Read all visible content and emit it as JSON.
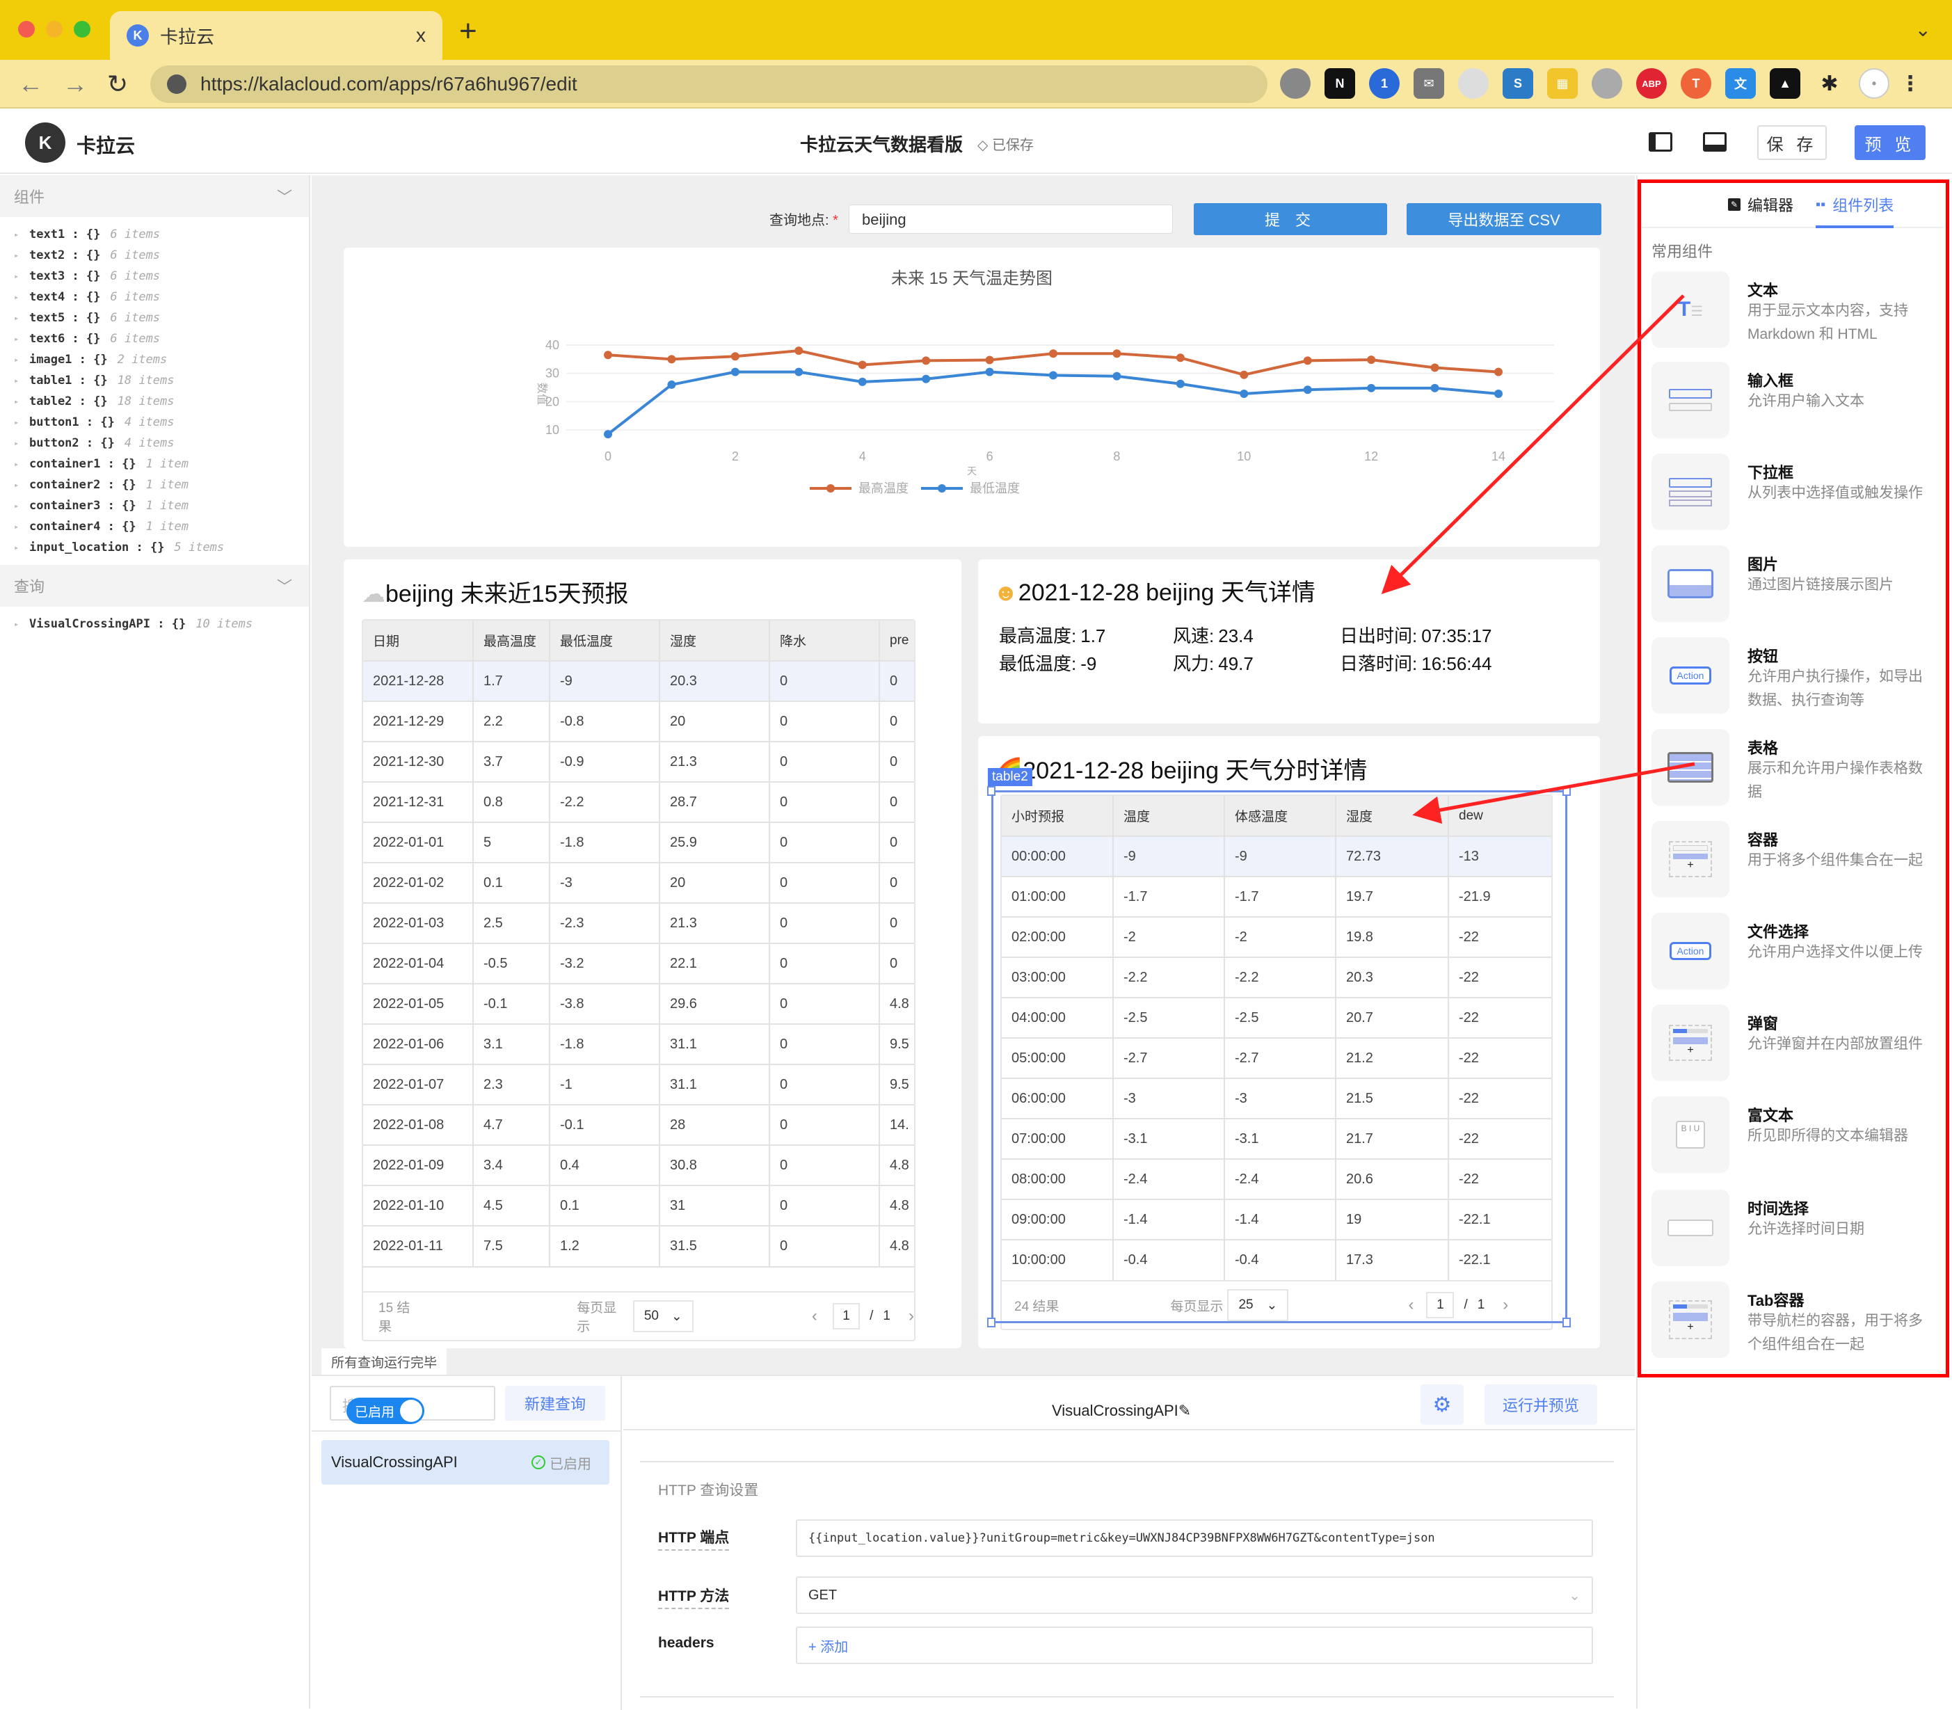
{
  "browser": {
    "tab_title": "卡拉云",
    "tab_close": "x",
    "new_tab": "+",
    "url": "https://kalacloud.com/apps/r67a6hu967/edit",
    "extensions": [
      "tomato-icon",
      "notion-icon",
      "1password-icon",
      "mail-icon",
      "gray-leaf-icon",
      "s-icon",
      "grid-icon",
      "egg-icon",
      "adblock-icon",
      "t-icon",
      "translate-icon",
      "a-icon",
      "puzzle-icon",
      "rabbit-avatar-icon"
    ]
  },
  "header": {
    "brand": "卡拉云",
    "app_title": "卡拉云天气数据看版",
    "saved_status": "已保存",
    "save_label": "保 存",
    "preview_label": "预 览"
  },
  "left_panel": {
    "components_title": "组件",
    "components": [
      {
        "key": "text1",
        "type": "{}",
        "count": "6 items"
      },
      {
        "key": "text2",
        "type": "{}",
        "count": "6 items"
      },
      {
        "key": "text3",
        "type": "{}",
        "count": "6 items"
      },
      {
        "key": "text4",
        "type": "{}",
        "count": "6 items"
      },
      {
        "key": "text5",
        "type": "{}",
        "count": "6 items"
      },
      {
        "key": "text6",
        "type": "{}",
        "count": "6 items"
      },
      {
        "key": "image1",
        "type": "{}",
        "count": "2 items"
      },
      {
        "key": "table1",
        "type": "{}",
        "count": "18 items"
      },
      {
        "key": "table2",
        "type": "{}",
        "count": "18 items"
      },
      {
        "key": "button1",
        "type": "{}",
        "count": "4 items"
      },
      {
        "key": "button2",
        "type": "{}",
        "count": "4 items"
      },
      {
        "key": "container1",
        "type": "{}",
        "count": "1 item"
      },
      {
        "key": "container2",
        "type": "{}",
        "count": "1 item"
      },
      {
        "key": "container3",
        "type": "{}",
        "count": "1 item"
      },
      {
        "key": "container4",
        "type": "{}",
        "count": "1 item"
      },
      {
        "key": "input_location",
        "type": "{}",
        "count": "5 items"
      }
    ],
    "queries_title": "查询",
    "queries": [
      {
        "key": "VisualCrossingAPI",
        "type": "{}",
        "count": "10 items"
      }
    ]
  },
  "canvas": {
    "location_label": "查询地点:",
    "location_value": "beijing",
    "submit_label": "提 交",
    "export_label": "导出数据至 CSV",
    "forecast": {
      "title": "beijing 未来近15天预报",
      "columns": [
        "日期",
        "最高温度",
        "最低温度",
        "湿度",
        "降水",
        "pre"
      ],
      "rows": [
        [
          "2021-12-28",
          "1.7",
          "-9",
          "20.3",
          "0",
          "0"
        ],
        [
          "2021-12-29",
          "2.2",
          "-0.8",
          "20",
          "0",
          "0"
        ],
        [
          "2021-12-30",
          "3.7",
          "-0.9",
          "21.3",
          "0",
          "0"
        ],
        [
          "2021-12-31",
          "0.8",
          "-2.2",
          "28.7",
          "0",
          "0"
        ],
        [
          "2022-01-01",
          "5",
          "-1.8",
          "25.9",
          "0",
          "0"
        ],
        [
          "2022-01-02",
          "0.1",
          "-3",
          "20",
          "0",
          "0"
        ],
        [
          "2022-01-03",
          "2.5",
          "-2.3",
          "21.3",
          "0",
          "0"
        ],
        [
          "2022-01-04",
          "-0.5",
          "-3.2",
          "22.1",
          "0",
          "0"
        ],
        [
          "2022-01-05",
          "-0.1",
          "-3.8",
          "29.6",
          "0",
          "4.8"
        ],
        [
          "2022-01-06",
          "3.1",
          "-1.8",
          "31.1",
          "0",
          "9.5"
        ],
        [
          "2022-01-07",
          "2.3",
          "-1",
          "31.1",
          "0",
          "9.5"
        ],
        [
          "2022-01-08",
          "4.7",
          "-0.1",
          "28",
          "0",
          "14."
        ],
        [
          "2022-01-09",
          "3.4",
          "0.4",
          "30.8",
          "0",
          "4.8"
        ],
        [
          "2022-01-10",
          "4.5",
          "0.1",
          "31",
          "0",
          "4.8"
        ],
        [
          "2022-01-11",
          "7.5",
          "1.2",
          "31.5",
          "0",
          "4.8"
        ]
      ],
      "result_count": "15 结果",
      "page_size_label": "每页显示",
      "page_size": "50",
      "page_current": "1",
      "page_sep": "/",
      "page_total": "1"
    },
    "detail": {
      "title": "2021-12-28 beijing 天气详情",
      "items": [
        {
          "label": "最高温度:",
          "value": "1.7"
        },
        {
          "label": "风速:",
          "value": "23.4"
        },
        {
          "label": "日出时间:",
          "value": "07:35:17"
        },
        {
          "label": "最低温度:",
          "value": "-9"
        },
        {
          "label": "风力:",
          "value": "49.7"
        },
        {
          "label": "日落时间:",
          "value": "16:56:44"
        }
      ]
    },
    "hourly": {
      "title": "2021-12-28 beijing 天气分时详情",
      "selection_tag": "table2",
      "columns": [
        "小时预报",
        "温度",
        "体感温度",
        "湿度",
        "dew"
      ],
      "rows": [
        [
          "00:00:00",
          "-9",
          "-9",
          "72.73",
          "-13"
        ],
        [
          "01:00:00",
          "-1.7",
          "-1.7",
          "19.7",
          "-21.9"
        ],
        [
          "02:00:00",
          "-2",
          "-2",
          "19.8",
          "-22"
        ],
        [
          "03:00:00",
          "-2.2",
          "-2.2",
          "20.3",
          "-22"
        ],
        [
          "04:00:00",
          "-2.5",
          "-2.5",
          "20.7",
          "-22"
        ],
        [
          "05:00:00",
          "-2.7",
          "-2.7",
          "21.2",
          "-22"
        ],
        [
          "06:00:00",
          "-3",
          "-3",
          "21.5",
          "-22"
        ],
        [
          "07:00:00",
          "-3.1",
          "-3.1",
          "21.7",
          "-22"
        ],
        [
          "08:00:00",
          "-2.4",
          "-2.4",
          "20.6",
          "-22"
        ],
        [
          "09:00:00",
          "-1.4",
          "-1.4",
          "19",
          "-22.1"
        ],
        [
          "10:00:00",
          "-0.4",
          "-0.4",
          "17.3",
          "-22.1"
        ]
      ],
      "result_count": "24 结果",
      "page_size_label": "每页显示",
      "page_size": "25",
      "page_current": "1",
      "page_sep": "/",
      "page_total": "1"
    }
  },
  "chart_data": {
    "type": "line",
    "title": "未来 15 天气温走势图",
    "xlabel": "天",
    "ylabel": "数值",
    "x": [
      0,
      1,
      2,
      3,
      4,
      5,
      6,
      7,
      8,
      9,
      10,
      11,
      12,
      13,
      14
    ],
    "x_ticks": [
      0,
      2,
      4,
      6,
      8,
      10,
      12,
      14
    ],
    "y_ticks": [
      10,
      20,
      30,
      40
    ],
    "ylim": [
      5,
      42
    ],
    "grid": true,
    "legend_position": "bottom",
    "series": [
      {
        "name": "最高温度",
        "color": "#d2673a",
        "values": [
          36.5,
          35,
          36,
          38,
          33,
          34.5,
          34.7,
          37,
          37,
          35.5,
          29.5,
          34.5,
          34.8,
          32,
          30.5
        ]
      },
      {
        "name": "最低温度",
        "color": "#3a86d6",
        "values": [
          8.5,
          26,
          30.5,
          30.5,
          27,
          28,
          30.5,
          29.3,
          29,
          26.3,
          22.8,
          24.2,
          24.8,
          24.8,
          22.8
        ]
      }
    ]
  },
  "right_panel": {
    "tab_editor": "编辑器",
    "tab_components": "组件列表",
    "section_title": "常用组件",
    "components": [
      {
        "name": "文本",
        "desc": "用于显示文本内容，支持 Markdown 和 HTML",
        "icon": "text-component-icon"
      },
      {
        "name": "输入框",
        "desc": "允许用户输入文本",
        "icon": "input-component-icon"
      },
      {
        "name": "下拉框",
        "desc": "从列表中选择值或触发操作",
        "icon": "select-component-icon"
      },
      {
        "name": "图片",
        "desc": "通过图片链接展示图片",
        "icon": "image-component-icon"
      },
      {
        "name": "按钮",
        "desc": "允许用户执行操作，如导出数据、执行查询等",
        "icon": "button-component-icon",
        "thumb_text": "Action"
      },
      {
        "name": "表格",
        "desc": "展示和允许用户操作表格数据",
        "icon": "table-component-icon"
      },
      {
        "name": "容器",
        "desc": "用于将多个组件集合在一起",
        "icon": "container-component-icon"
      },
      {
        "name": "文件选择",
        "desc": "允许用户选择文件以便上传",
        "icon": "file-picker-component-icon",
        "thumb_text": "Action"
      },
      {
        "name": "弹窗",
        "desc": "允许弹窗并在内部放置组件",
        "icon": "modal-component-icon"
      },
      {
        "name": "富文本",
        "desc": "所见即所得的文本编辑器",
        "icon": "rich-text-component-icon",
        "thumb_text": "B I U"
      },
      {
        "name": "时间选择",
        "desc": "允许选择时间日期",
        "icon": "date-picker-component-icon"
      },
      {
        "name": "Tab容器",
        "desc": "带导航栏的容器，用于将多个组件组合在一起",
        "icon": "tab-container-component-icon"
      }
    ]
  },
  "query_panel": {
    "status": "所有查询运行完毕",
    "search_placeholder": "搜索",
    "new_query_label": "新建查询",
    "query_item_name": "VisualCrossingAPI",
    "query_item_status": "已启用",
    "toggle_label": "已启用",
    "query_name": "VisualCrossingAPI",
    "run_label": "运行并预览",
    "http_section": "HTTP 查询设置",
    "endpoint_label": "HTTP 端点",
    "endpoint_value": "{{input_location.value}}?unitGroup=metric&key=UWXNJ84CP39BNFPX8WW6H7GZT&contentType=json",
    "method_label": "HTTP 方法",
    "method_value": "GET",
    "headers_label": "headers",
    "headers_add": "+ 添加"
  },
  "colors": {
    "brand_yellow": "#f1cc08",
    "accent_blue": "#4f7ff0",
    "button_blue": "#3d8fde",
    "annotation_red": "#ff0000"
  }
}
